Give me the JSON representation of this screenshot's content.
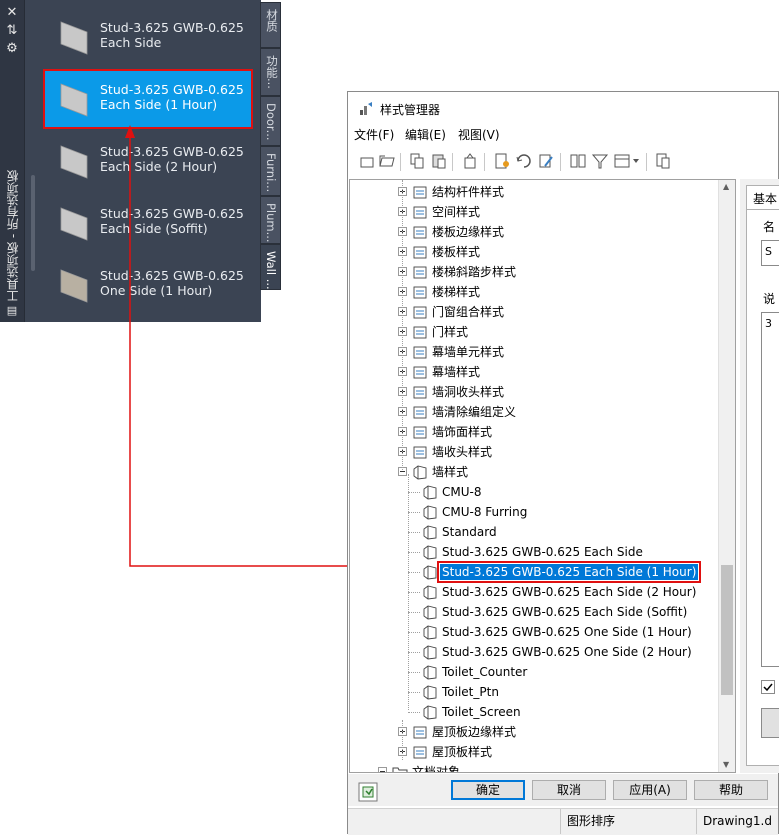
{
  "palette": {
    "title": "工具选项板 - 所有选项板",
    "strip_buttons": [
      "✕",
      "⇅",
      "⚙"
    ],
    "items": [
      {
        "line1": "Stud-3.625 GWB-0.625",
        "line2": "Each Side",
        "selected": false
      },
      {
        "line1": "Stud-3.625 GWB-0.625",
        "line2": "Each Side (1 Hour)",
        "selected": true
      },
      {
        "line1": "Stud-3.625 GWB-0.625",
        "line2": "Each Side (2 Hour)",
        "selected": false
      },
      {
        "line1": "Stud-3.625 GWB-0.625",
        "line2": "Each Side (Soffit)",
        "selected": false
      },
      {
        "line1": "Stud-3.625 GWB-0.625",
        "line2": "One Side (1 Hour)",
        "selected": false
      }
    ],
    "tabs": [
      "材质",
      "功能...",
      "Door...",
      "Furni...",
      "Plum...",
      "Wall ..."
    ]
  },
  "window": {
    "title": "样式管理器",
    "menus": [
      "文件(F)",
      "编辑(E)",
      "视图(V)"
    ],
    "tree": [
      {
        "label": "结构杆件样式",
        "icon": "member-style-icon",
        "expander": "plus"
      },
      {
        "label": "空间样式",
        "icon": "space-style-icon",
        "expander": "plus"
      },
      {
        "label": "楼板边缘样式",
        "icon": "slab-edge-style-icon",
        "expander": "plus"
      },
      {
        "label": "楼板样式",
        "icon": "slab-style-icon",
        "expander": "plus"
      },
      {
        "label": "楼梯斜踏步样式",
        "icon": "stair-winder-style-icon",
        "expander": "plus"
      },
      {
        "label": "楼梯样式",
        "icon": "stair-style-icon",
        "expander": "plus"
      },
      {
        "label": "门窗组合样式",
        "icon": "door-window-assembly-icon",
        "expander": "plus"
      },
      {
        "label": "门样式",
        "icon": "door-style-icon",
        "expander": "plus"
      },
      {
        "label": "幕墙单元样式",
        "icon": "curtain-wall-unit-icon",
        "expander": "plus"
      },
      {
        "label": "幕墙样式",
        "icon": "curtain-wall-style-icon",
        "expander": "plus"
      },
      {
        "label": "墙洞收头样式",
        "icon": "wall-opening-endcap-icon",
        "expander": "plus"
      },
      {
        "label": "墙清除编组定义",
        "icon": "wall-cleanup-group-icon",
        "expander": "plus"
      },
      {
        "label": "墙饰面样式",
        "icon": "wall-sweep-icon",
        "expander": "plus"
      },
      {
        "label": "墙收头样式",
        "icon": "wall-endcap-icon",
        "expander": "plus"
      },
      {
        "label": "墙样式",
        "icon": "wall-style-icon",
        "expander": "minus"
      },
      {
        "label": "CMU-8",
        "icon": "wall-icon",
        "child": true
      },
      {
        "label": "CMU-8 Furring",
        "icon": "wall-icon",
        "child": true
      },
      {
        "label": "Standard",
        "icon": "wall-icon",
        "child": true
      },
      {
        "label": "Stud-3.625 GWB-0.625 Each Side",
        "icon": "wall-icon",
        "child": true
      },
      {
        "label": "Stud-3.625 GWB-0.625 Each Side (1 Hour)",
        "icon": "wall-icon",
        "child": true,
        "selected": true
      },
      {
        "label": "Stud-3.625 GWB-0.625 Each Side (2 Hour)",
        "icon": "wall-icon",
        "child": true
      },
      {
        "label": "Stud-3.625 GWB-0.625 Each Side (Soffit)",
        "icon": "wall-icon",
        "child": true
      },
      {
        "label": "Stud-3.625 GWB-0.625 One Side (1 Hour)",
        "icon": "wall-icon",
        "child": true
      },
      {
        "label": "Stud-3.625 GWB-0.625 One Side (2 Hour)",
        "icon": "wall-icon",
        "child": true
      },
      {
        "label": "Toilet_Counter",
        "icon": "wall-icon",
        "child": true
      },
      {
        "label": "Toilet_Ptn",
        "icon": "wall-icon",
        "child": true
      },
      {
        "label": "Toilet_Screen",
        "icon": "wall-icon",
        "child": true
      },
      {
        "label": "屋顶板边缘样式",
        "icon": "roof-slab-edge-icon",
        "expander": "plus"
      },
      {
        "label": "屋顶板样式",
        "icon": "roof-slab-style-icon",
        "expander": "plus"
      },
      {
        "label": "文档对象",
        "icon": "folder-icon",
        "expander": "minus",
        "root": true
      }
    ],
    "right_panel": {
      "tab": "基本",
      "name_label": "名",
      "name_value": "S",
      "desc_label": "说",
      "desc_value": "3"
    },
    "buttons": {
      "ok": "确定",
      "cancel": "取消",
      "apply": "应用(A)",
      "help": "帮助"
    },
    "status": {
      "sort": "图形排序",
      "drawing": "Drawing1.d"
    }
  },
  "colors": {
    "palette_bg": "#3b4453",
    "selection_blue": "#0078d7",
    "highlight_red": "#e01010"
  }
}
